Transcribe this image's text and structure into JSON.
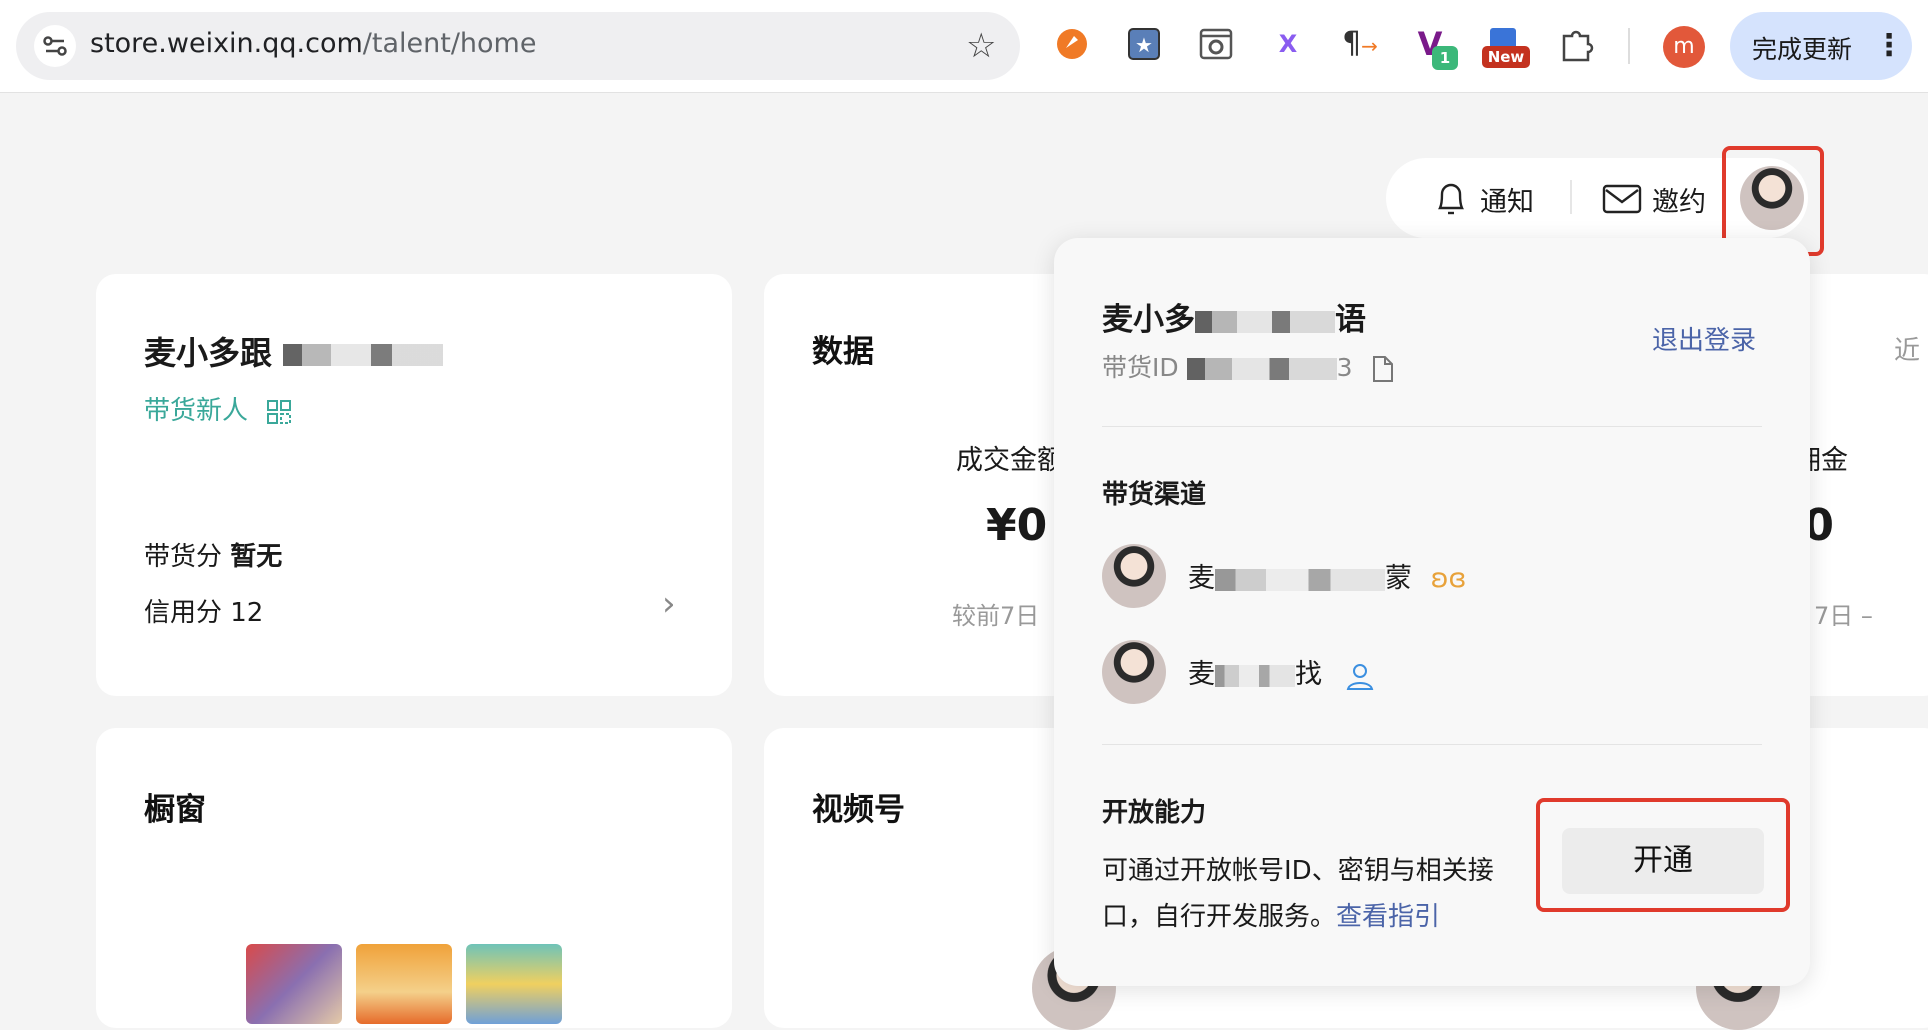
{
  "browser": {
    "url_domain": "store.weixin.qq.com",
    "url_path": "/talent/home",
    "update_label": "完成更新",
    "profile_letter": "m",
    "ext_badge_count": "1",
    "ext_new_badge": "New"
  },
  "topbar": {
    "notify_label": "通知",
    "invite_label": "邀约"
  },
  "profile_card": {
    "name": "麦小多跟",
    "tag": "带货新人",
    "score_label": "带货分",
    "score_value": "暂无",
    "credit_label": "信用分 12"
  },
  "data_card": {
    "title": "数据",
    "gmv_label": "成交金额",
    "gmv_value": "¥0",
    "compare_label": "较前7日",
    "commission_label": "佣金",
    "commission_value": "¥0",
    "commission_compare": "7日 –",
    "recent_label": "近"
  },
  "window_card": {
    "title": "橱窗"
  },
  "video_card": {
    "title": "视频号"
  },
  "dropdown": {
    "name": "麦小多",
    "name_tail": "语",
    "id_label": "带货ID",
    "id_tail": "3",
    "logout": "退出登录",
    "channels_title": "带货渠道",
    "channel_1": "麦",
    "channel_1_tail": "蒙",
    "channel_2": "麦",
    "channel_2_tail": "找",
    "open_title": "开放能力",
    "open_desc_1": "可通过开放帐号ID、密钥与相关接",
    "open_desc_2": "口，自行开发服务。",
    "open_link": "查看指引",
    "open_button": "开通"
  },
  "colors": {
    "accent_green": "#3aa89a",
    "link_blue": "#4b64a8",
    "highlight_red": "#e03a2c"
  }
}
